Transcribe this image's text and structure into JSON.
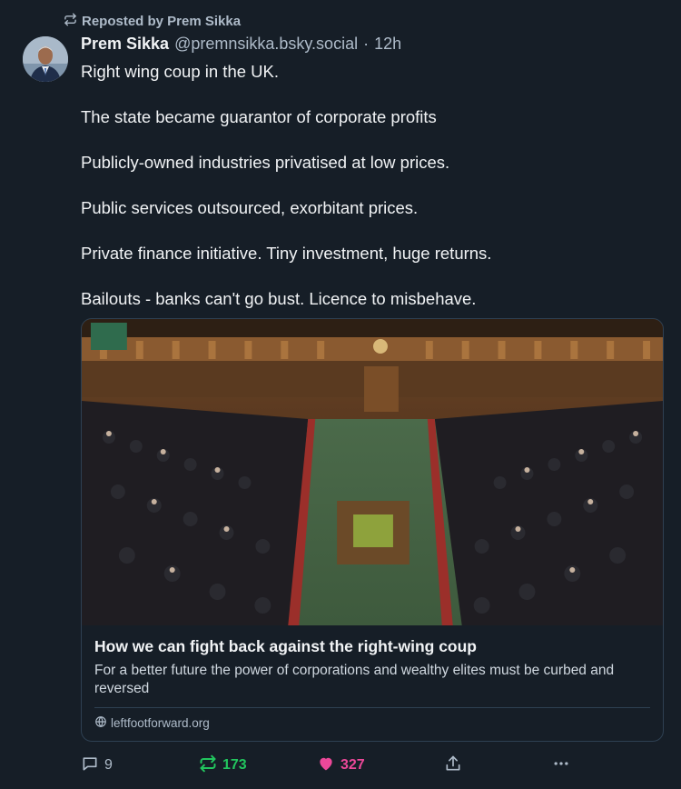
{
  "repost_notice": {
    "text": "Reposted by Prem Sikka",
    "icon": "repost-icon"
  },
  "post": {
    "author_name": "Prem Sikka",
    "author_handle": "@premnsikka.bsky.social",
    "separator": "·",
    "timestamp": "12h",
    "paragraphs": [
      "Right wing coup in the UK.",
      "The state became guarantor of corporate profits",
      "Publicly-owned industries privatised at low prices.",
      "Public services outsourced, exorbitant prices.",
      "Private finance initiative. Tiny investment, huge returns.",
      "Bailouts - banks can't go bust. Licence to misbehave."
    ]
  },
  "embed": {
    "image_icon": "parliament-chamber-photo",
    "title": "How we can fight back against the right-wing coup",
    "description": "For a better future the power of corporations and wealthy elites must be curbed and reversed",
    "domain": "leftfootforward.org",
    "domain_icon": "globe-icon"
  },
  "actions": {
    "reply_count": "9",
    "repost_count": "173",
    "like_count": "327"
  },
  "colors": {
    "background": "#161e27",
    "text_primary": "#f1f3f5",
    "text_secondary": "#aebbc9",
    "repost_active": "#22c55e",
    "like_active": "#ec4899",
    "border": "#2e4052"
  }
}
